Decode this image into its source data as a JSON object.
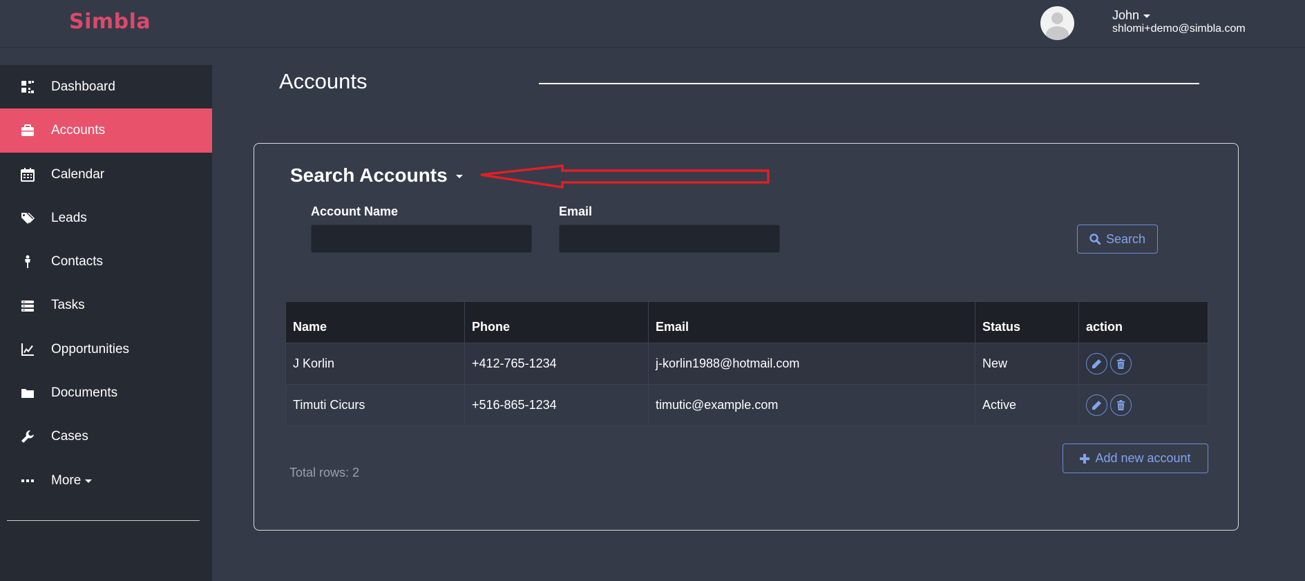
{
  "app": {
    "logo": "Simbla"
  },
  "user": {
    "name": "John",
    "email": "shlomi+demo@simbla.com"
  },
  "sidebar": {
    "items": [
      {
        "label": "Dashboard",
        "icon": "dashboard-icon"
      },
      {
        "label": "Accounts",
        "icon": "briefcase-icon",
        "active": true
      },
      {
        "label": "Calendar",
        "icon": "calendar-icon"
      },
      {
        "label": "Leads",
        "icon": "tags-icon"
      },
      {
        "label": "Contacts",
        "icon": "person-icon"
      },
      {
        "label": "Tasks",
        "icon": "tasks-icon"
      },
      {
        "label": "Opportunities",
        "icon": "line-chart-icon"
      },
      {
        "label": "Documents",
        "icon": "folder-icon"
      },
      {
        "label": "Cases",
        "icon": "wrench-icon"
      },
      {
        "label": "More",
        "icon": "ellipsis-icon"
      }
    ]
  },
  "page": {
    "title": "Accounts"
  },
  "search": {
    "title": "Search Accounts",
    "account_name_label": "Account Name",
    "account_name_value": "",
    "email_label": "Email",
    "email_value": "",
    "search_button": "Search"
  },
  "table": {
    "headers": [
      "Name",
      "Phone",
      "Email",
      "Status",
      "action"
    ],
    "rows": [
      {
        "name": "J Korlin",
        "phone": "+412-765-1234",
        "email": "j-korlin1988@hotmail.com",
        "status": "New"
      },
      {
        "name": "Timuti Cicurs",
        "phone": "+516-865-1234",
        "email": "timutic@example.com",
        "status": "Active"
      }
    ]
  },
  "footer": {
    "total_rows": "Total rows: 2",
    "add_button": "Add new account"
  },
  "colors": {
    "accent": "#e8526a",
    "link": "#7fa4f0",
    "annotation": "#e01f26"
  }
}
